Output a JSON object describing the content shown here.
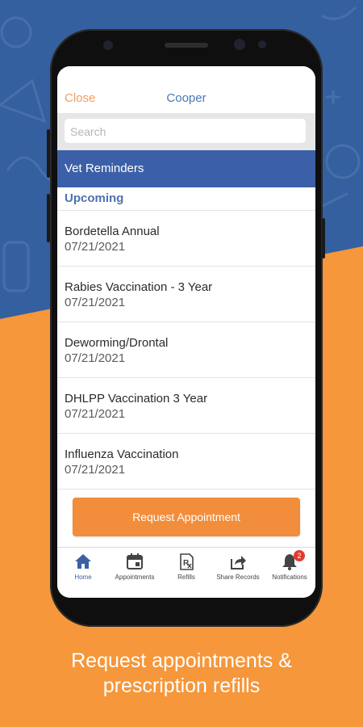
{
  "colors": {
    "blue_bg": "#34609f",
    "orange_bg": "#f5973a",
    "header_blue": "#3c60a8",
    "accent_orange": "#f28d3b",
    "link_orange": "#f29d5e",
    "badge_red": "#e23a2e"
  },
  "header": {
    "close_label": "Close",
    "pet_name": "Cooper"
  },
  "search": {
    "placeholder": "Search"
  },
  "section": {
    "title": "Vet Reminders",
    "subheading": "Upcoming"
  },
  "reminders": [
    {
      "name": "Bordetella Annual",
      "date": "07/21/2021"
    },
    {
      "name": "Rabies Vaccination - 3 Year",
      "date": "07/21/2021"
    },
    {
      "name": "Deworming/Drontal",
      "date": "07/21/2021"
    },
    {
      "name": "DHLPP Vaccination 3 Year",
      "date": "07/21/2021"
    },
    {
      "name": "Influenza Vaccination",
      "date": "07/21/2021"
    }
  ],
  "actions": {
    "request_appointment": "Request Appointment"
  },
  "tabs": [
    {
      "label": "Home",
      "icon": "home-icon",
      "active": true
    },
    {
      "label": "Appointments",
      "icon": "calendar-icon",
      "active": false
    },
    {
      "label": "Refills",
      "icon": "prescription-icon",
      "active": false
    },
    {
      "label": "Share Records",
      "icon": "share-icon",
      "active": false
    },
    {
      "label": "Notifications",
      "icon": "bell-icon",
      "active": false,
      "badge": "2"
    }
  ],
  "caption": {
    "line1": "Request appointments &",
    "line2": "prescription refills"
  }
}
